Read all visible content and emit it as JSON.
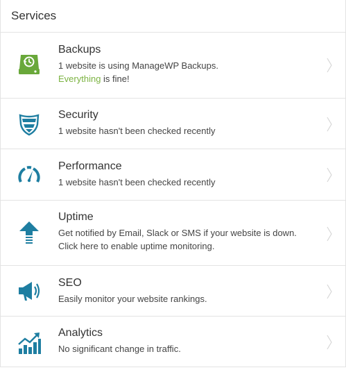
{
  "panel": {
    "title": "Services"
  },
  "colors": {
    "icon_teal": "#1e7ea1",
    "icon_green": "#69a83a",
    "ok_green": "#7cb342",
    "chevron": "#d6d6d6",
    "border": "#e3e3e3"
  },
  "services": [
    {
      "name": "Backups",
      "icon": "hard-drive-clock-icon",
      "line1": "1 website is using ManageWP Backups.",
      "status_highlight": "Everything",
      "status_rest": " is fine!"
    },
    {
      "name": "Security",
      "icon": "shield-icon",
      "line1": "1 website hasn't been checked recently"
    },
    {
      "name": "Performance",
      "icon": "speedometer-icon",
      "line1": "1 website hasn't been checked recently"
    },
    {
      "name": "Uptime",
      "icon": "arrow-up-icon",
      "line1": "Get notified by Email, Slack or SMS if your website is down.",
      "line2": "Click here to enable uptime monitoring."
    },
    {
      "name": "SEO",
      "icon": "megaphone-icon",
      "line1": "Easily monitor your website rankings."
    },
    {
      "name": "Analytics",
      "icon": "bar-chart-trend-icon",
      "line1": "No significant change in traffic."
    }
  ]
}
